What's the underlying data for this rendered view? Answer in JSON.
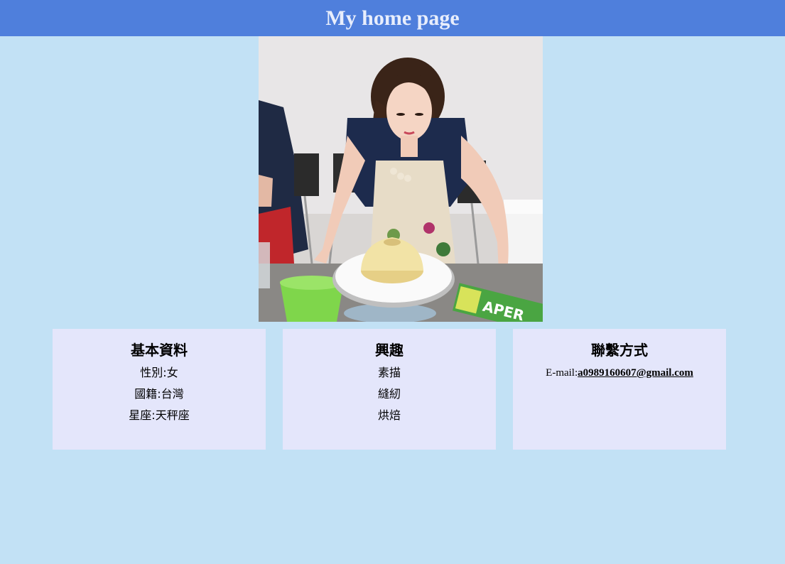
{
  "header": {
    "title": "My home page"
  },
  "photo": {
    "icon": "profile-photo",
    "alt": "",
    "tin_text": "APER"
  },
  "cards": {
    "basic": {
      "title": "基本資料",
      "items": [
        "性別:女",
        "國籍:台灣",
        "星座:天秤座"
      ]
    },
    "hobby": {
      "title": "興趣",
      "items": [
        "素描",
        "縫紉",
        "烘焙"
      ]
    },
    "contact": {
      "title": "聯繫方式",
      "email_label": "E-mail:",
      "email": "a0989160607@gmail.com"
    }
  },
  "colors": {
    "page_bg": "#c2e1f5",
    "header_bg": "#4f7fdc",
    "header_text": "#e8eefc",
    "card_bg": "#e4e6fb"
  }
}
